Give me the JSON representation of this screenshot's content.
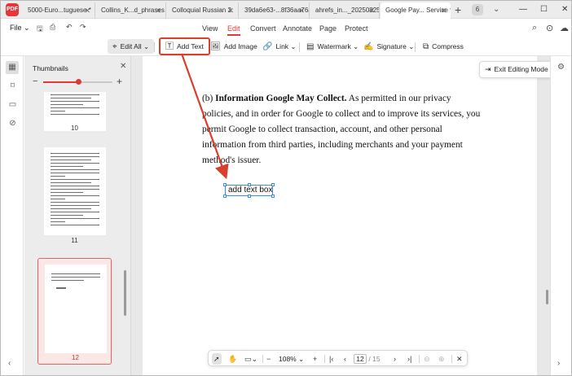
{
  "app": {
    "logo_text": "PDF"
  },
  "tabs": [
    {
      "label": "5000-Euro...tuguese *"
    },
    {
      "label": "Collins_K...d_phrases"
    },
    {
      "label": "Colloquial Russian 2"
    },
    {
      "label": "39da6e63-...8f36aa76ad"
    },
    {
      "label": "ahrefs_in..._20250825"
    },
    {
      "label": "Google Pay... Service *"
    }
  ],
  "tab_count": "6",
  "menu": {
    "file_label": "File",
    "tabs": [
      "View",
      "Edit",
      "Convert",
      "Annotate",
      "Page",
      "Protect"
    ],
    "active_tab": "Edit"
  },
  "toolbar": {
    "edit_all": "Edit All",
    "add_text": "Add Text",
    "add_image": "Add Image",
    "link": "Link",
    "watermark": "Watermark",
    "signature": "Signature",
    "compress": "Compress"
  },
  "thumbnails": {
    "title": "Thumbnails",
    "zoom_level": 0.5,
    "pages": [
      {
        "number": "10"
      },
      {
        "number": "11"
      },
      {
        "number": "12",
        "active": true
      }
    ]
  },
  "document": {
    "paragraph_heading": "Information Google May Collect.",
    "paragraph_prefix": "(b)",
    "paragraph_body": "As permitted in our privacy policies, and in order for Google to collect and to improve its services, you permit Google to collect transaction, account, and other personal information from third parties, including merchants and your payment method's issuer.",
    "text_box_value": "add text box",
    "exit_editing": "Exit Editing Mode"
  },
  "bottom_nav": {
    "zoom": "108%",
    "current_page": "12",
    "total_pages": "15",
    "page_separator": "/"
  },
  "colors": {
    "accent": "#e5373a",
    "annotation_red": "#d8402c",
    "selection_blue": "#3c8ee0"
  }
}
